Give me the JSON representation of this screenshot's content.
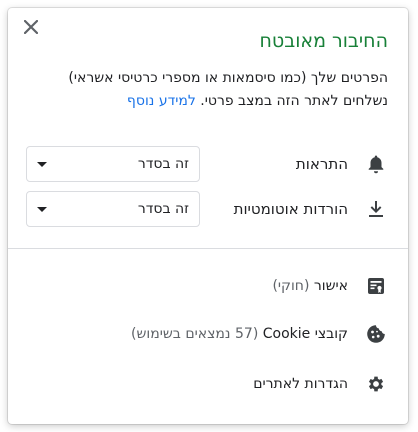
{
  "dialog": {
    "close_icon": "close-icon",
    "title": "החיבור מאובטח",
    "description": "הפרטים שלך (כמו סיסמאות או מספרי כרטיסי אשראי) נשלחים לאתר הזה במצב פרטי.",
    "learn_more": "למידע נוסף",
    "title_color": "#188038",
    "link_color": "#1a73e8"
  },
  "permissions": [
    {
      "icon": "bell-icon",
      "label": "התראות",
      "value": "זה בסדר"
    },
    {
      "icon": "download-icon",
      "label": "הורדות אוטומטיות",
      "value": "זה בסדר"
    }
  ],
  "info_items": [
    {
      "icon": "certificate-icon",
      "label": "אישור",
      "detail": "(חוקי)"
    },
    {
      "icon": "cookie-icon",
      "label": "קובצי Cookie",
      "detail": "(57 נמצאים בשימוש)"
    },
    {
      "icon": "gear-icon",
      "label": "הגדרות לאתרים",
      "detail": ""
    }
  ]
}
